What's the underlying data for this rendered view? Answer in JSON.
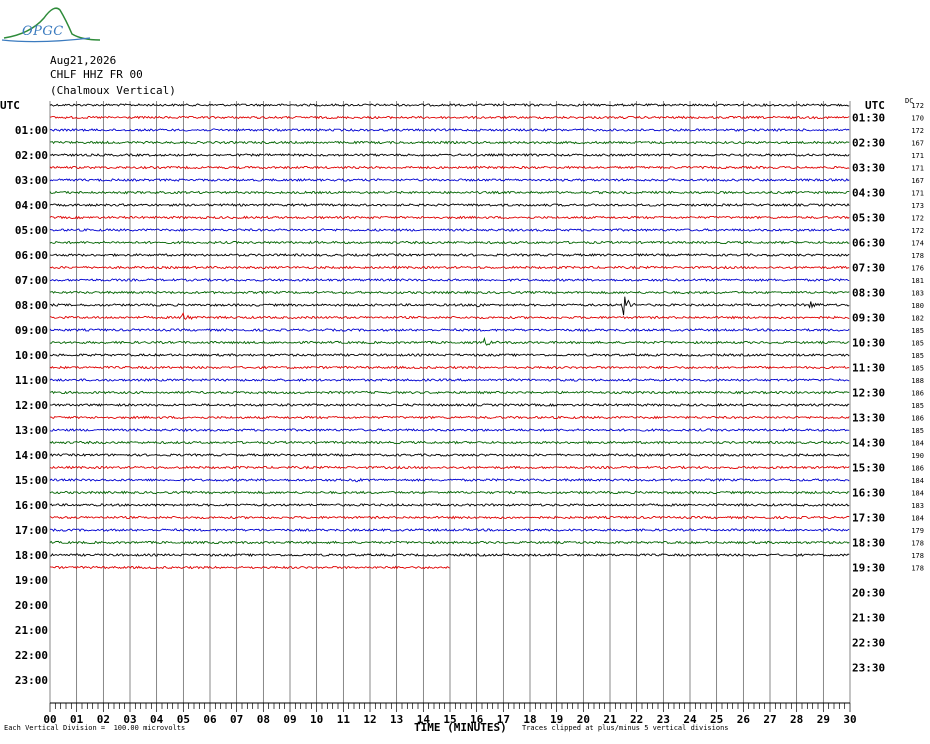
{
  "logo": {
    "text": "OPGC"
  },
  "header": {
    "date": "Aug21,2026",
    "station": "CHLF HHZ FR 00",
    "location": "(Chalmoux Vertical)"
  },
  "axis": {
    "utc_left": "UTC",
    "utc_right": "UTC",
    "dc_label": "DC",
    "xlabel": "TIME (MINUTES)",
    "x_ticks": [
      "00",
      "01",
      "02",
      "03",
      "04",
      "05",
      "06",
      "07",
      "08",
      "09",
      "10",
      "11",
      "12",
      "13",
      "14",
      "15",
      "16",
      "17",
      "18",
      "19",
      "20",
      "21",
      "22",
      "23",
      "24",
      "25",
      "26",
      "27",
      "28",
      "29",
      "30"
    ],
    "left_hour_labels": [
      "01:00",
      "02:00",
      "03:00",
      "04:00",
      "05:00",
      "06:00",
      "07:00",
      "08:00",
      "09:00",
      "10:00",
      "11:00",
      "12:00",
      "13:00",
      "14:00",
      "15:00",
      "16:00",
      "17:00",
      "18:00",
      "19:00",
      "20:00",
      "21:00",
      "22:00",
      "23:00"
    ],
    "right_hour_labels": [
      "01:30",
      "02:30",
      "03:30",
      "04:30",
      "05:30",
      "06:30",
      "07:30",
      "08:30",
      "09:30",
      "10:30",
      "11:30",
      "12:30",
      "13:30",
      "14:30",
      "15:30",
      "16:30",
      "17:30",
      "18:30",
      "19:30",
      "20:30",
      "21:30",
      "22:30",
      "23:30"
    ]
  },
  "footer": {
    "division": "Each Vertical Division =  100.00 microvolts",
    "clip": "Traces clipped at plus/minus 5 vertical divisions"
  },
  "chart_data": {
    "type": "line",
    "title": "",
    "xlabel": "TIME (MINUTES)",
    "xlim": [
      0,
      30
    ],
    "trace_colors": [
      "#000000",
      "#e00000",
      "#0000d0",
      "#006400"
    ],
    "traces": [
      {
        "dc": "172"
      },
      {
        "dc": "170"
      },
      {
        "dc": "172"
      },
      {
        "dc": "167"
      },
      {
        "dc": "171"
      },
      {
        "dc": "171"
      },
      {
        "dc": "167"
      },
      {
        "dc": "171"
      },
      {
        "dc": "173"
      },
      {
        "dc": "172"
      },
      {
        "dc": "172"
      },
      {
        "dc": "174"
      },
      {
        "dc": "178"
      },
      {
        "dc": "176"
      },
      {
        "dc": "181"
      },
      {
        "dc": "183"
      },
      {
        "dc": "180",
        "events": [
          {
            "minute": 16.0,
            "amp": 6
          },
          {
            "minute": 21.5,
            "amp": 16
          },
          {
            "minute": 28.5,
            "amp": 8
          }
        ]
      },
      {
        "dc": "182",
        "events": [
          {
            "minute": 5.0,
            "amp": 10
          }
        ]
      },
      {
        "dc": "185"
      },
      {
        "dc": "185",
        "events": [
          {
            "minute": 16.3,
            "amp": 5
          }
        ]
      },
      {
        "dc": "185"
      },
      {
        "dc": "185"
      },
      {
        "dc": "188"
      },
      {
        "dc": "186"
      },
      {
        "dc": "185"
      },
      {
        "dc": "186"
      },
      {
        "dc": "185"
      },
      {
        "dc": "184"
      },
      {
        "dc": "190"
      },
      {
        "dc": "186"
      },
      {
        "dc": "184",
        "events": [
          {
            "minute": 11.5,
            "amp": 4
          }
        ]
      },
      {
        "dc": "184"
      },
      {
        "dc": "183"
      },
      {
        "dc": "184"
      },
      {
        "dc": "179"
      },
      {
        "dc": "178"
      },
      {
        "dc": "178"
      },
      {
        "dc": "178",
        "end_minute": 15
      }
    ]
  }
}
